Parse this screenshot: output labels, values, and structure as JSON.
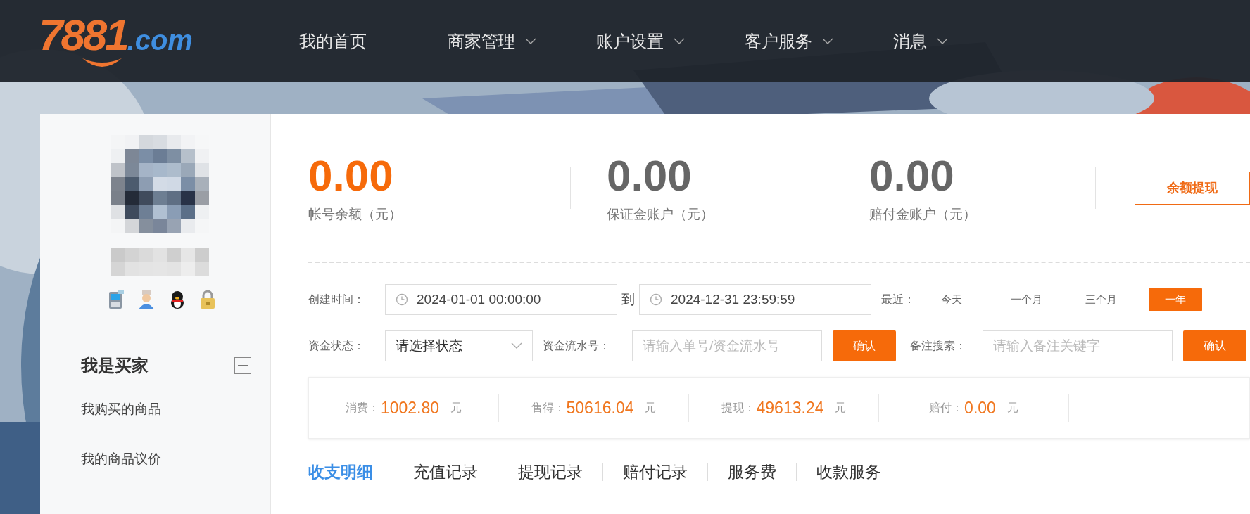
{
  "logo": {
    "text_a": "7881",
    "text_b": ".com"
  },
  "nav": [
    {
      "label": "我的首页",
      "dropdown": false
    },
    {
      "label": "商家管理",
      "dropdown": true
    },
    {
      "label": "账户设置",
      "dropdown": true
    },
    {
      "label": "客户服务",
      "dropdown": true
    },
    {
      "label": "消息",
      "dropdown": true
    }
  ],
  "sidebar": {
    "section_title": "我是买家",
    "expanded": true,
    "items": [
      "我购买的商品",
      "我的商品议价"
    ]
  },
  "balances": [
    {
      "amount": "0.00",
      "label": "帐号余额（元）",
      "highlight": true
    },
    {
      "amount": "0.00",
      "label": "保证金账户（元）",
      "highlight": false
    },
    {
      "amount": "0.00",
      "label": "赔付金账户（元）",
      "highlight": false
    }
  ],
  "withdraw_button": "余额提现",
  "filters": {
    "created_label": "创建时间：",
    "date_from": "2024-01-01 00:00:00",
    "to_label": "到",
    "date_to": "2024-12-31 23:59:59",
    "recent_label": "最近：",
    "recent_options": [
      {
        "label": "今天",
        "selected": false
      },
      {
        "label": "一个月",
        "selected": false
      },
      {
        "label": "三个月",
        "selected": false
      },
      {
        "label": "一年",
        "selected": true
      }
    ],
    "status_label": "资金状态：",
    "status_value": "请选择状态",
    "serial_label": "资金流水号：",
    "serial_placeholder": "请输入单号/资金流水号",
    "confirm_1": "确认",
    "note_label": "备注搜索：",
    "note_placeholder": "请输入备注关键字",
    "confirm_2": "确认"
  },
  "summary": [
    {
      "label": "消费：",
      "value": "1002.80",
      "unit": "元"
    },
    {
      "label": "售得：",
      "value": "50616.04",
      "unit": "元"
    },
    {
      "label": "提现：",
      "value": "49613.24",
      "unit": "元"
    },
    {
      "label": "赔付：",
      "value": "0.00",
      "unit": "元"
    }
  ],
  "tabs": [
    {
      "label": "收支明细",
      "selected": true
    },
    {
      "label": "充值记录",
      "selected": false
    },
    {
      "label": "提现记录",
      "selected": false
    },
    {
      "label": "赔付记录",
      "selected": false
    },
    {
      "label": "服务费",
      "selected": false
    },
    {
      "label": "收款服务",
      "selected": false
    }
  ]
}
